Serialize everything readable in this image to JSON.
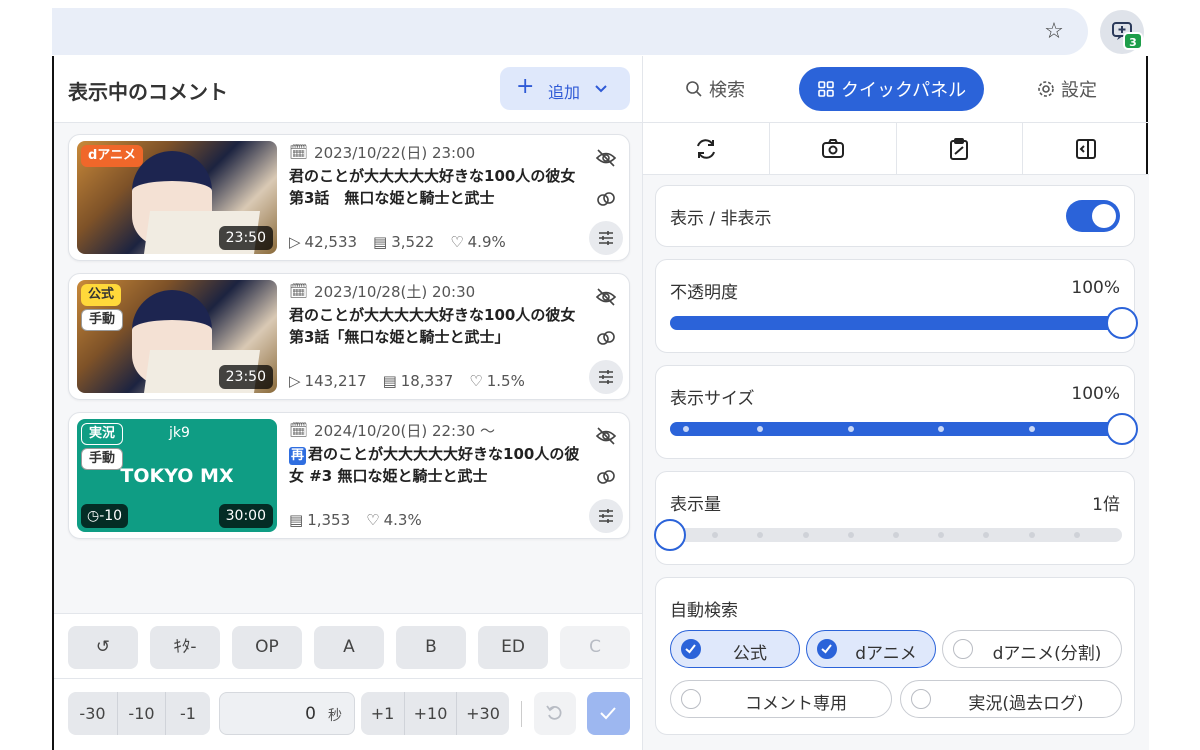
{
  "browser": {
    "extension_badge": "3"
  },
  "left": {
    "title": "表示中のコメント",
    "add_label": "追加",
    "cards": [
      {
        "badges": [
          "dアニメ"
        ],
        "duration": "23:50",
        "date": "2023/10/22(日) 23:00",
        "title": "君のことが大大大大大好きな100人の彼女　第3話　無口な姫と騎士と武士",
        "views": "42,533",
        "comments": "3,522",
        "likes": "4.9%"
      },
      {
        "badges": [
          "公式",
          "手動"
        ],
        "duration": "23:50",
        "date": "2023/10/28(土) 20:30",
        "title": "君のことが大大大大大好きな100人の彼女 第3話「無口な姫と騎士と武士」",
        "views": "143,217",
        "comments": "18,337",
        "likes": "1.5%"
      },
      {
        "badges": [
          "実況",
          "手動"
        ],
        "channel_id": "jk9",
        "channel_name": "TOKYO MX",
        "offset": "-10",
        "duration": "30:00",
        "date": "2024/10/20(日) 22:30 〜",
        "rebroadcast_mark": "再",
        "title": "君のことが大大大大大好きな100人の彼女 #3 無口な姫と騎士と武士",
        "comments": "1,353",
        "likes": "4.3%"
      }
    ],
    "chapters": [
      "ｷﾀ-",
      "OP",
      "A",
      "B",
      "ED",
      "C"
    ],
    "seek_back": [
      "-30",
      "-10",
      "-1"
    ],
    "seek_value": "0",
    "seek_unit": "秒",
    "seek_fwd": [
      "+1",
      "+10",
      "+30"
    ]
  },
  "right": {
    "tabs": {
      "search": "検索",
      "quick": "クイックパネル",
      "settings": "設定"
    },
    "visibility": {
      "label": "表示 / 非表示",
      "on": true
    },
    "opacity": {
      "label": "不透明度",
      "value": "100%",
      "level": 1.0
    },
    "size": {
      "label": "表示サイズ",
      "value": "100%",
      "level": 1.0
    },
    "amount": {
      "label": "表示量",
      "value": "1倍",
      "level": 0.0
    },
    "auto_search": {
      "label": "自動検索",
      "options": [
        {
          "label": "公式",
          "checked": true
        },
        {
          "label": "dアニメ",
          "checked": true
        },
        {
          "label": "dアニメ(分割)",
          "checked": false
        },
        {
          "label": "コメント専用",
          "checked": false
        },
        {
          "label": "実況(過去ログ)",
          "checked": false
        }
      ]
    }
  },
  "colors": {
    "accent": "#2b63d9",
    "danime": "#f0672a",
    "official": "#ffd83a",
    "live": "#0f9d84"
  }
}
